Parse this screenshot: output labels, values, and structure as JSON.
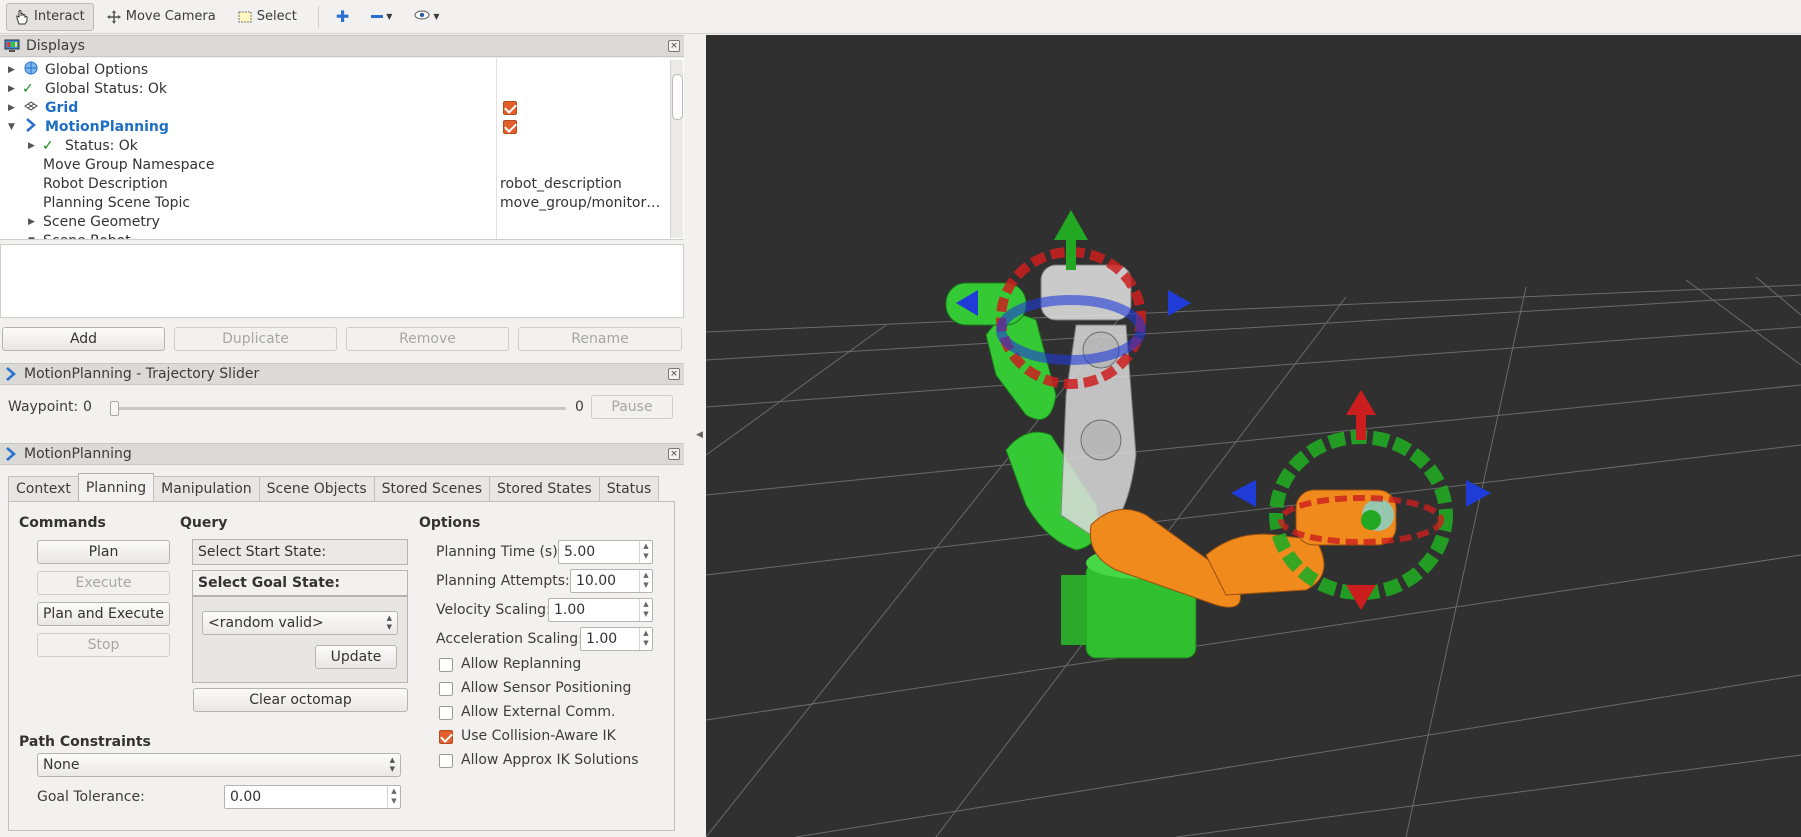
{
  "toolbar": {
    "interact": "Interact",
    "move_camera": "Move Camera",
    "select": "Select"
  },
  "displays": {
    "title": "Displays",
    "close": "×",
    "rows": [
      {
        "label": "Global Options",
        "value": ""
      },
      {
        "label": "Global Status: Ok",
        "value": ""
      },
      {
        "label": "Grid",
        "value": ""
      },
      {
        "label": "MotionPlanning",
        "value": ""
      },
      {
        "label": "Status: Ok",
        "value": ""
      },
      {
        "label": "Move Group Namespace",
        "value": ""
      },
      {
        "label": "Robot Description",
        "value": "robot_description"
      },
      {
        "label": "Planning Scene Topic",
        "value": "move_group/monitor…"
      },
      {
        "label": "Scene Geometry",
        "value": ""
      },
      {
        "label": "Scene Robot",
        "value": ""
      }
    ],
    "buttons": {
      "add": "Add",
      "duplicate": "Duplicate",
      "remove": "Remove",
      "rename": "Rename"
    }
  },
  "trajectory_slider": {
    "title": "MotionPlanning - Trajectory Slider",
    "waypoint_label": "Waypoint:",
    "waypoint_value": "0",
    "waypoint_max": "0",
    "pause": "Pause"
  },
  "motion_planning": {
    "title": "MotionPlanning",
    "tabs": [
      "Context",
      "Planning",
      "Manipulation",
      "Scene Objects",
      "Stored Scenes",
      "Stored States",
      "Status"
    ],
    "selected_tab": "Planning",
    "commands": {
      "heading": "Commands",
      "plan": "Plan",
      "execute": "Execute",
      "plan_and_execute": "Plan and Execute",
      "stop": "Stop"
    },
    "query": {
      "heading": "Query",
      "start_state": "Select Start State:",
      "goal_state": "Select Goal State:",
      "goal_option": "<random valid>",
      "update": "Update",
      "clear_octomap": "Clear octomap"
    },
    "options": {
      "heading": "Options",
      "planning_time_label": "Planning Time (s):",
      "planning_time": "5.00",
      "planning_attempts_label": "Planning Attempts:",
      "planning_attempts": "10.00",
      "velocity_scaling_label": "Velocity Scaling:",
      "velocity_scaling": "1.00",
      "acceleration_scaling_label": "Acceleration Scaling:",
      "acceleration_scaling": "1.00",
      "checkboxes": [
        {
          "label": "Allow Replanning",
          "checked": false
        },
        {
          "label": "Allow Sensor Positioning",
          "checked": false
        },
        {
          "label": "Allow External Comm.",
          "checked": false
        },
        {
          "label": "Use Collision-Aware IK",
          "checked": true
        },
        {
          "label": "Allow Approx IK Solutions",
          "checked": false
        }
      ]
    },
    "path_constraints": {
      "heading": "Path Constraints",
      "value": "None",
      "goal_tolerance_label": "Goal Tolerance:",
      "goal_tolerance": "0.00"
    }
  },
  "colors": {
    "accent_orange": "#e05f2b",
    "link_blue": "#1e6fc4",
    "viewport_bg": "#303030",
    "robot_green": "#3fd23f",
    "robot_orange": "#f08a1c"
  }
}
